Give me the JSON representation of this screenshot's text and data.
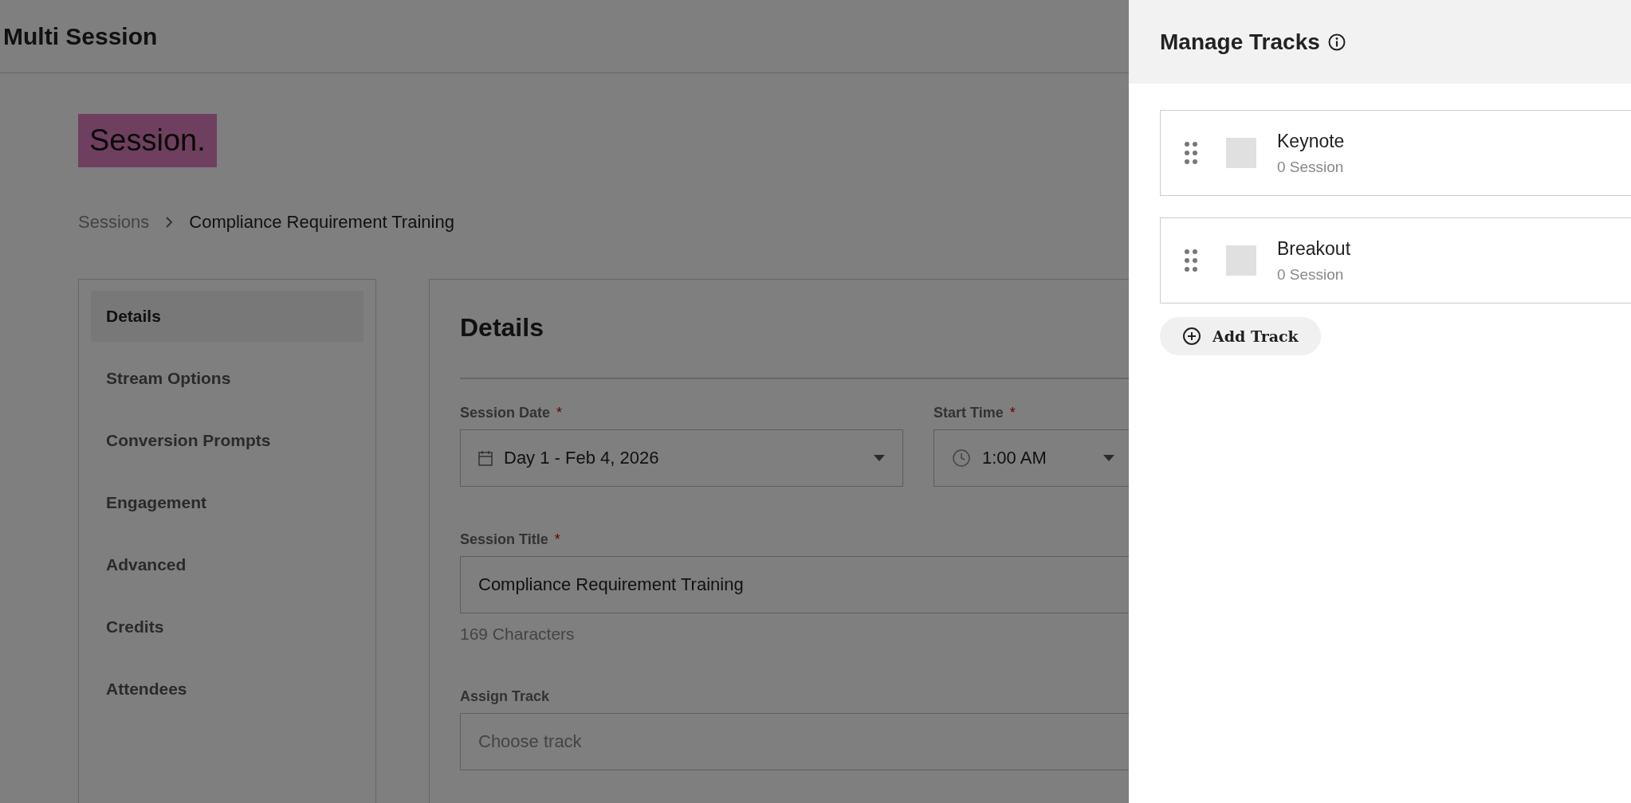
{
  "page": {
    "title": "Multi Session",
    "logo": "Session.",
    "breadcrumb": [
      {
        "label": "Sessions",
        "current": false
      },
      {
        "label": "Compliance Requirement Training",
        "current": true
      }
    ],
    "nav": [
      {
        "label": "Details",
        "selected": true
      },
      {
        "label": "Stream Options",
        "selected": false
      },
      {
        "label": "Conversion Prompts",
        "selected": false
      },
      {
        "label": "Engagement",
        "selected": false
      },
      {
        "label": "Advanced",
        "selected": false
      },
      {
        "label": "Credits",
        "selected": false
      },
      {
        "label": "Attendees",
        "selected": false
      }
    ],
    "details": {
      "heading": "Details",
      "session_date": {
        "label": "Session Date",
        "required_mark": "*",
        "value": "Day 1 - Feb 4, 2026"
      },
      "start_time": {
        "label": "Start Time",
        "required_mark": "*",
        "value": "1:00 AM"
      },
      "session_title": {
        "label": "Session Title",
        "required_mark": "*",
        "value": "Compliance Requirement Training"
      },
      "char_count": "169 Characters",
      "assign_track": {
        "label": "Assign Track",
        "placeholder": "Choose track"
      }
    }
  },
  "panel": {
    "title": "Manage Tracks",
    "tracks": [
      {
        "name": "Keynote",
        "count": "0 Session"
      },
      {
        "name": "Breakout",
        "count": "0 Session"
      }
    ],
    "add_button": "Add Track"
  }
}
